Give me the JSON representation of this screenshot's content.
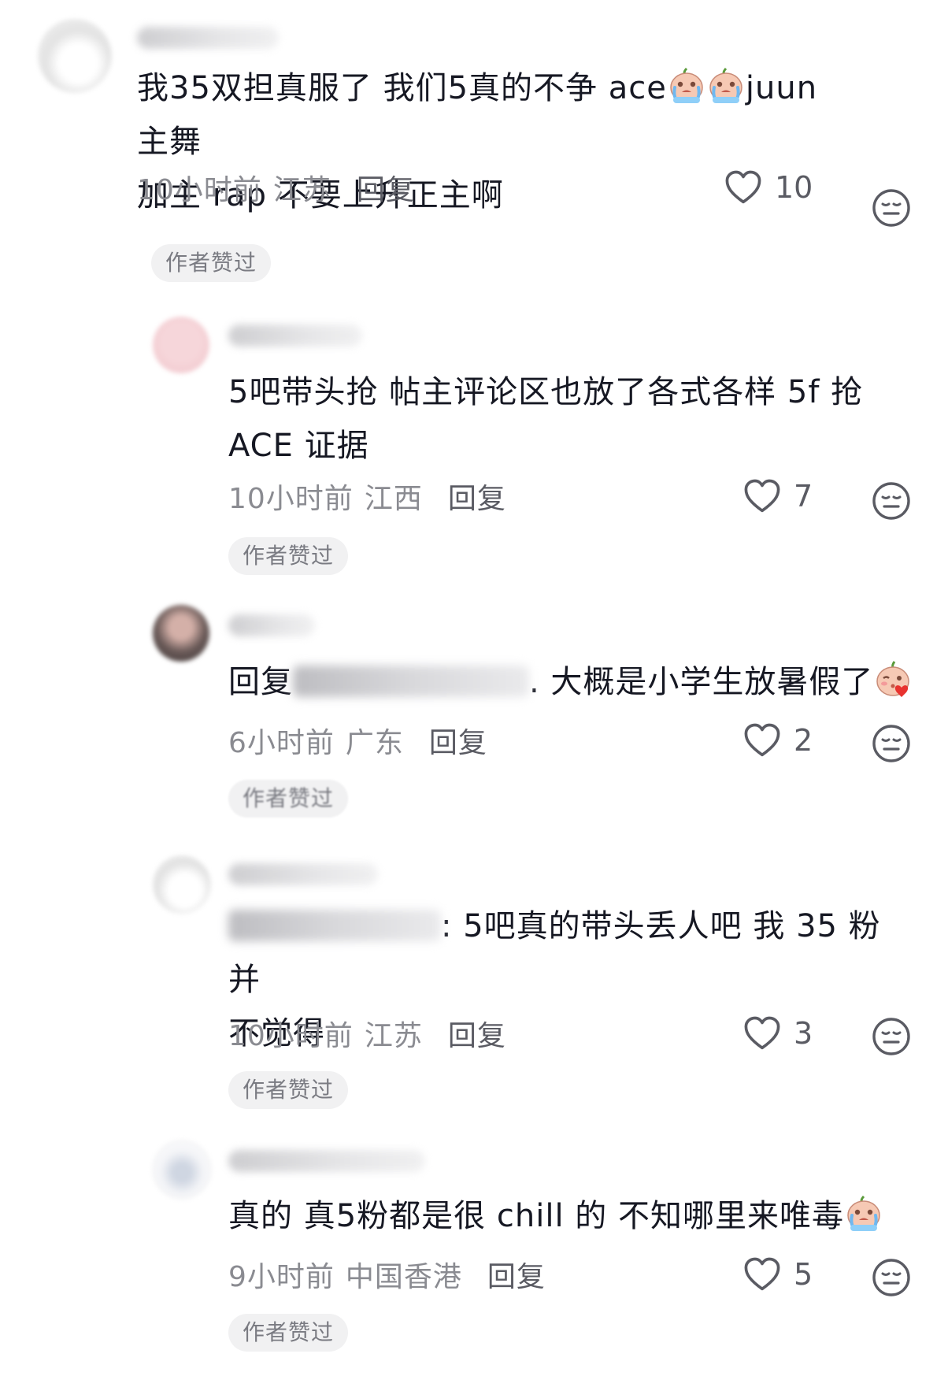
{
  "comments": [
    {
      "text_a": "我35双担真服了 我们5真的不争 ace",
      "text_b": "juun 主舞",
      "text_c": "加主 rap 不要上升正主啊",
      "time": "10小时前",
      "location": "江苏",
      "reply_label": "回复",
      "likes": "10",
      "badge": "作者赞过"
    },
    {
      "text_a": "5吧带头抢 帖主评论区也放了各式各样 5f 抢",
      "text_b": "ACE 证据",
      "time": "10小时前",
      "location": "江西",
      "reply_label": "回复",
      "likes": "7",
      "badge": "作者赞过"
    },
    {
      "text_prefix": "回复",
      "text_main": ". 大概是小学生放暑假了",
      "time": "6小时前",
      "location": "广东",
      "reply_label": "回复",
      "likes": "2",
      "badge": "作者赞过"
    },
    {
      "text_main": ": 5吧真的带头丢人吧 我 35 粉并",
      "text_b": "不觉得",
      "time": "10小时前",
      "location": "江苏",
      "reply_label": "回复",
      "likes": "3",
      "badge": "作者赞过"
    },
    {
      "text_a": "真的 真5粉都是很 chill 的 不知哪里来唯毒",
      "time": "9小时前",
      "location": "中国香港",
      "reply_label": "回复",
      "likes": "5",
      "badge": "作者赞过"
    }
  ],
  "icons": {
    "like": "heart-outline-icon",
    "dislike": "neutral-face-icon",
    "emoji_crying": "crying-peach-emoji",
    "emoji_blush": "blushing-peach-emoji"
  },
  "colors": {
    "text": "#161823",
    "meta": "#8a8b91",
    "badge_bg": "#f1f1f2"
  }
}
